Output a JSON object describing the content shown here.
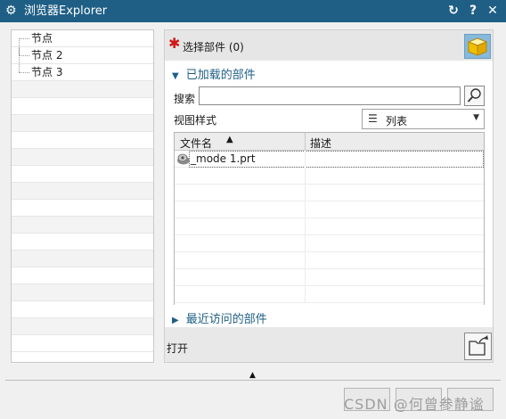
{
  "window": {
    "title": "浏览器Explorer"
  },
  "titlebar_buttons": [
    "refresh-icon",
    "help-icon",
    "close-icon"
  ],
  "tree": {
    "items": [
      {
        "label": "节点"
      },
      {
        "label": "节点 2"
      },
      {
        "label": "节点 3"
      }
    ]
  },
  "select_part": {
    "label": "选择部件 (0)"
  },
  "loaded_parts": {
    "header": "已加载的部件",
    "search_label": "搜索",
    "search_value": "",
    "view_style_label": "视图样式",
    "view_style_value": "列表",
    "columns": [
      "文件名",
      "描述"
    ],
    "rows": [
      {
        "name": "_mode 1.prt",
        "description": ""
      }
    ]
  },
  "recent_parts": {
    "header": "最近访问的部件"
  },
  "open": {
    "label": "打开"
  },
  "watermark": "CSDN @何曾参静谧",
  "colors": {
    "titlebar": "#1f5f85",
    "accent": "#1f5f85",
    "required": "#d01818"
  }
}
